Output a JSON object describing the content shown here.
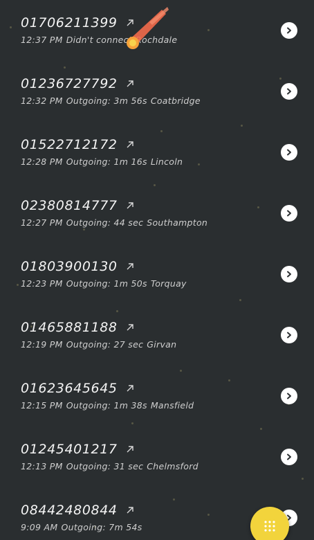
{
  "calls": [
    {
      "number": "01706211399",
      "time": "12:37 PM",
      "status": "Didn't connect",
      "location": "Rochdale"
    },
    {
      "number": "01236727792",
      "time": "12:32 PM",
      "status": "Outgoing: 3m 56s",
      "location": "Coatbridge"
    },
    {
      "number": "01522712172",
      "time": "12:28 PM",
      "status": "Outgoing: 1m 16s",
      "location": "Lincoln"
    },
    {
      "number": "02380814777",
      "time": "12:27 PM",
      "status": "Outgoing: 44 sec",
      "location": "Southampton"
    },
    {
      "number": "01803900130",
      "time": "12:23 PM",
      "status": "Outgoing: 1m 50s",
      "location": "Torquay"
    },
    {
      "number": "01465881188",
      "time": "12:19 PM",
      "status": "Outgoing: 27 sec",
      "location": "Girvan"
    },
    {
      "number": "01623645645",
      "time": "12:15 PM",
      "status": "Outgoing: 1m 38s",
      "location": "Mansfield"
    },
    {
      "number": "01245401217",
      "time": "12:13 PM",
      "status": "Outgoing: 31 sec",
      "location": "Chelmsford"
    },
    {
      "number": "08442480844",
      "time": "9:09 AM",
      "status": "Outgoing: 7m 54s",
      "location": ""
    }
  ],
  "icons": {
    "call_direction": "outgoing-call-arrow-icon",
    "row_action": "chevron-right-icon",
    "fab": "dialpad-icon",
    "decoration": "comet-icon"
  },
  "colors": {
    "background": "#2a2e30",
    "fab": "#f2d43c",
    "comet": "#f26a4b"
  }
}
